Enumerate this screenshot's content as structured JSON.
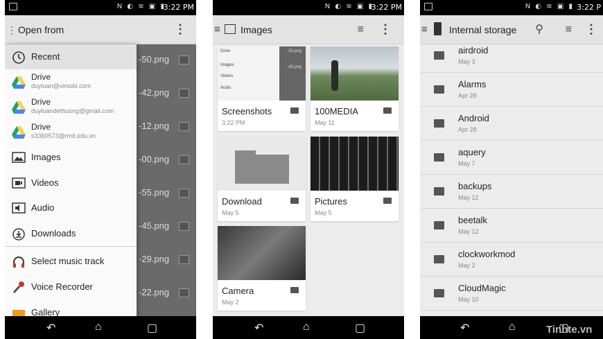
{
  "status": {
    "time": "3:22 PM",
    "time_short": "3:22 PM",
    "time_cut": "3:22 P"
  },
  "watermark": "Tinhte.vn",
  "screen1": {
    "title": "Open from",
    "menu": "⋮",
    "background_files": [
      "-50.png",
      "-42.png",
      "-12.png",
      "-00.png",
      "-55.png",
      "-45.png",
      "-29.png",
      "-22.png"
    ],
    "items": [
      {
        "label": "Recent",
        "icon": "clock-icon"
      },
      {
        "label": "Drive",
        "sub": "duyluan@vimobi.com",
        "icon": "drive-icon"
      },
      {
        "label": "Drive",
        "sub": "duyluandethuong@gmail.com",
        "icon": "drive-icon"
      },
      {
        "label": "Drive",
        "sub": "s3360573@rmit.edu.vn",
        "icon": "drive-icon"
      },
      {
        "label": "Images",
        "icon": "image-icon"
      },
      {
        "label": "Videos",
        "icon": "video-icon"
      },
      {
        "label": "Audio",
        "icon": "audio-icon"
      },
      {
        "label": "Downloads",
        "icon": "download-icon"
      },
      {
        "label": "Select music track",
        "icon": "headphones-icon"
      },
      {
        "label": "Voice Recorder",
        "icon": "microphone-icon"
      },
      {
        "label": "Gallery",
        "icon": "gallery-icon"
      }
    ]
  },
  "screen2": {
    "title": "Images",
    "cards": [
      {
        "name": "Screenshots",
        "date": "3:22 PM"
      },
      {
        "name": "100MEDIA",
        "date": "May 11"
      },
      {
        "name": "Download",
        "date": "May 5"
      },
      {
        "name": "Pictures",
        "date": "May 5"
      },
      {
        "name": "Camera",
        "date": "May 2"
      }
    ],
    "mini_drawer": [
      "Drive",
      "Images",
      "Videos",
      "Audio"
    ],
    "mini_files": [
      "-52.png",
      "-42.png"
    ]
  },
  "screen3": {
    "title": "Internal storage",
    "folders": [
      {
        "name": "airdroid",
        "date": "May 3"
      },
      {
        "name": "Alarms",
        "date": "Apr 28"
      },
      {
        "name": "Android",
        "date": "Apr 28"
      },
      {
        "name": "aquery",
        "date": "May 7"
      },
      {
        "name": "backups",
        "date": "May 12"
      },
      {
        "name": "beetalk",
        "date": "May 12"
      },
      {
        "name": "clockworkmod",
        "date": "May 2"
      },
      {
        "name": "CloudMagic",
        "date": "May 10"
      }
    ]
  },
  "nav": {
    "back": "↶",
    "home": "⌂",
    "recents": "▢"
  },
  "colors": {
    "drive_green": "#1fa463",
    "drive_yellow": "#ffd04b",
    "drive_blue": "#4688f4"
  }
}
